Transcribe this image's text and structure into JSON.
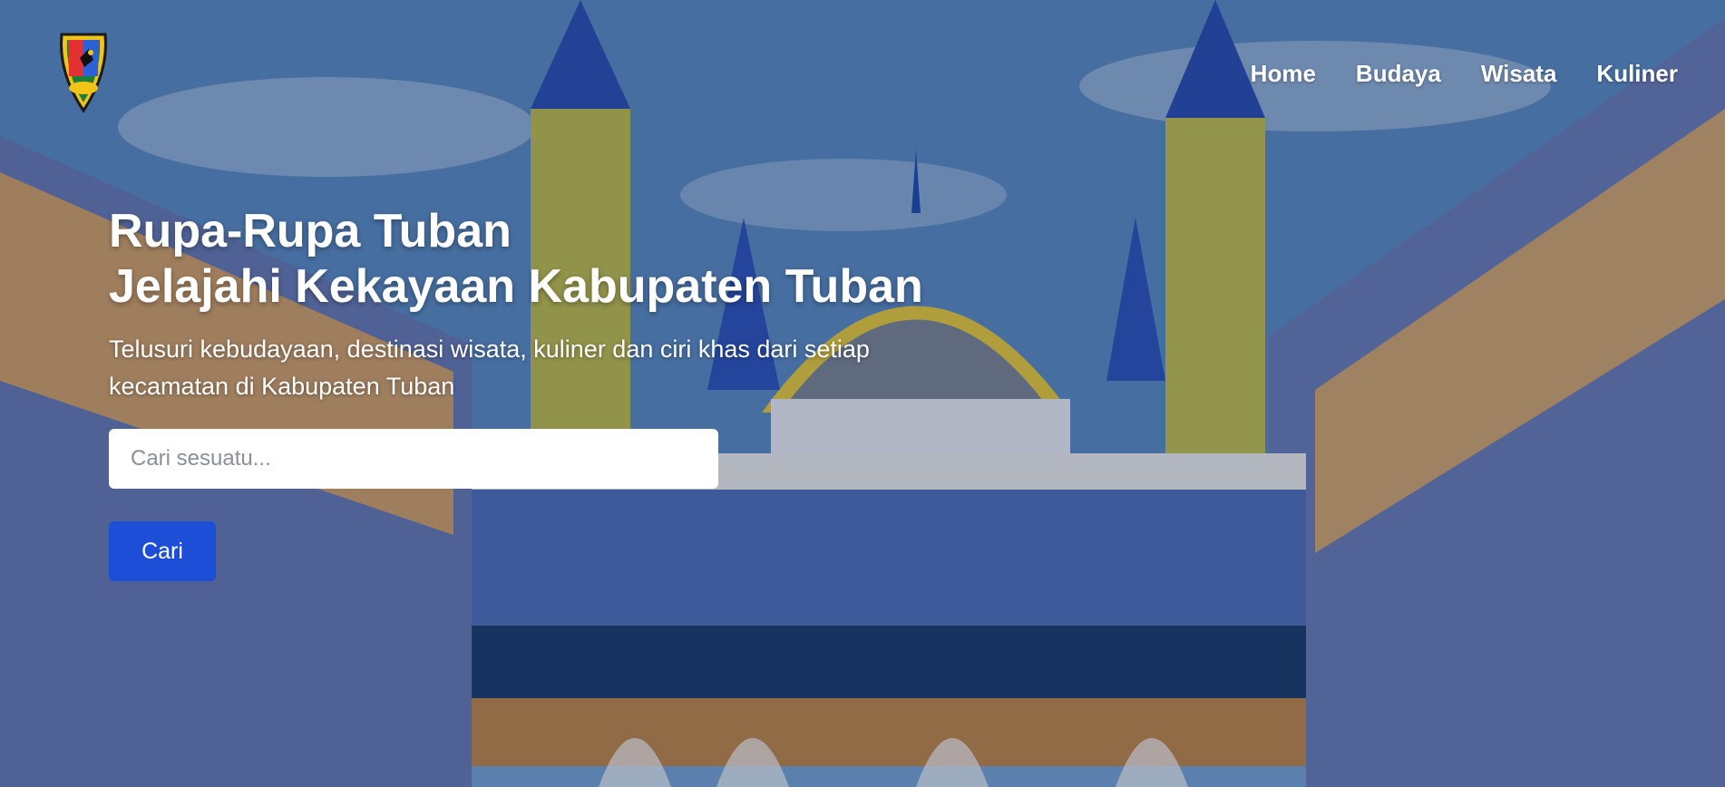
{
  "header": {
    "logo_icon": "kabupaten-tuban-crest-icon",
    "nav": [
      "Home",
      "Budaya",
      "Wisata",
      "Kuliner"
    ]
  },
  "hero": {
    "title_line1": "Rupa-Rupa Tuban",
    "title_line2": "Jelajahi Kekayaan Kabupaten Tuban",
    "subtitle": "Telusuri kebudayaan, destinasi wisata, kuliner dan ciri khas dari setiap kecamatan di Kabupaten Tuban",
    "search_placeholder": "Cari sesuatu...",
    "search_value": "",
    "search_button": "Cari"
  },
  "colors": {
    "button": "#1d4ed8",
    "sky": "#5c8cc3"
  }
}
